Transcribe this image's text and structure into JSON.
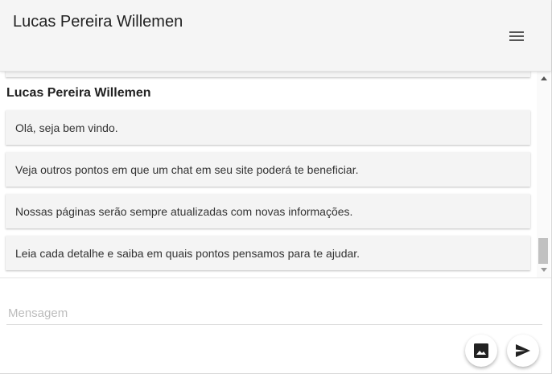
{
  "header": {
    "title": "Lucas Pereira Willemen",
    "menu_icon": "menu-icon"
  },
  "chat": {
    "sender_name": "Lucas Pereira Willemen",
    "messages": [
      "Olá, seja bem vindo.",
      "Veja outros pontos em que um chat em seu site poderá te beneficiar.",
      "Nossas páginas serão sempre atualizadas com novas informações.",
      "Leia cada detalhe e saiba em quais pontos pensamos para te ajudar."
    ]
  },
  "composer": {
    "placeholder": "Mensagem",
    "value": "",
    "image_icon": "image-icon",
    "send_icon": "send-icon"
  }
}
